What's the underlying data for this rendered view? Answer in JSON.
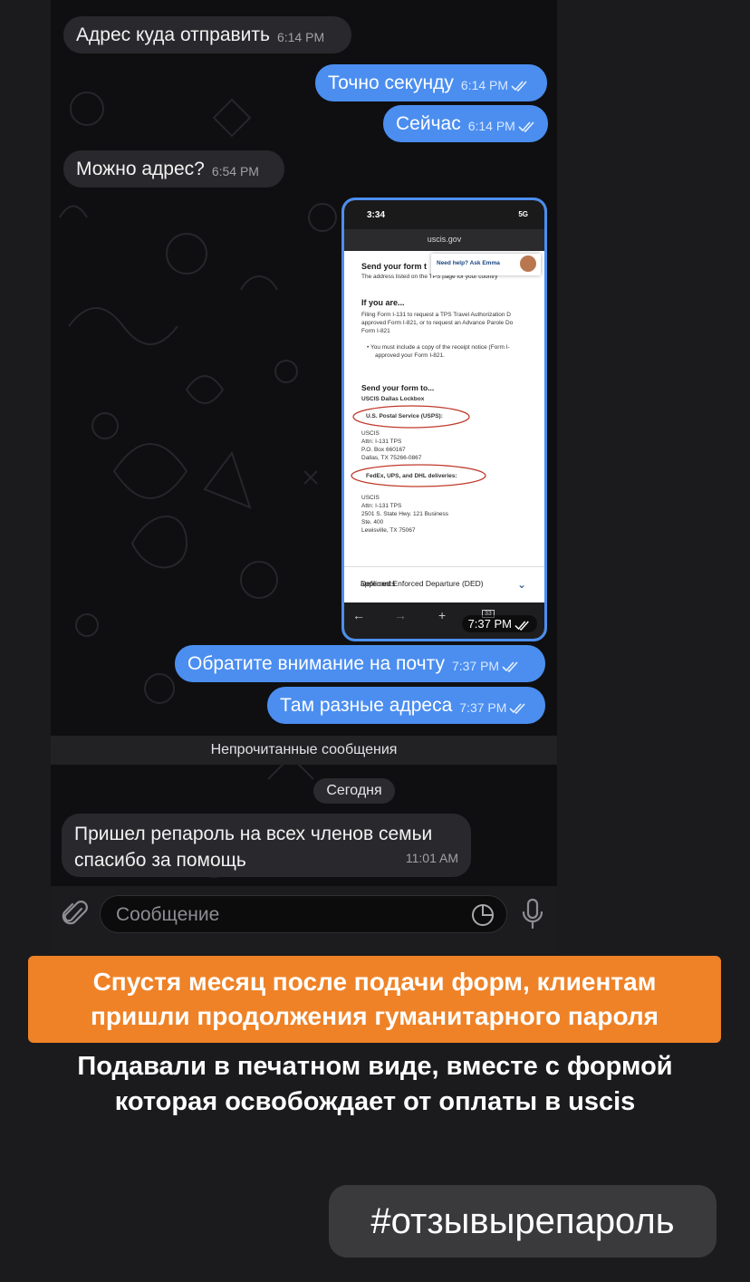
{
  "chat": {
    "messages": [
      {
        "text": "Адрес куда отправить",
        "time": "6:14 PM"
      },
      {
        "text": "Точно секунду",
        "time": "6:14 PM"
      },
      {
        "text": "Сейчас",
        "time": "6:14 PM"
      },
      {
        "text": "Можно адрес?",
        "time": "6:54 PM"
      },
      {
        "text": "Обратите внимание на почту",
        "time": "7:37 PM"
      },
      {
        "text": "Там разные адреса",
        "time": "7:37 PM"
      },
      {
        "text_line1": "Пришел репароль на всех членов семьи",
        "text_line2": "спасибо за помощь",
        "time": "11:01 AM"
      }
    ],
    "unread_label": "Непрочитанные сообщения",
    "date_label": "Сегодня",
    "image_message": {
      "time": "7:37 PM",
      "status_time": "3:34",
      "status_carrier": "5G",
      "url": "uscis.gov",
      "help_text": "Need help? Ask Emma",
      "send_form_title": "Send your form t",
      "send_form_sub": "The address listed on the TPS page for your country",
      "if_you_are": "If you are...",
      "filing_line1": "Filing Form I-131 to request a TPS Travel Authorization D",
      "filing_line2": "approved Form I-821, or to request an Advance Parole Do",
      "filing_line3": "Form I-821",
      "bullet_line1": "• You must include a copy of the receipt notice (Form I-",
      "bullet_line2": "approved your Form I-821.",
      "send_to": "Send your form to...",
      "lockbox": "USCIS Dallas Lockbox",
      "usps_label": "U.S. Postal Service (USPS):",
      "usps_addr": [
        "USCIS",
        "Attn: I-131 TPS",
        "P.O. Box 660167",
        "Dallas, TX 75266-0867"
      ],
      "courier_label": "FedEx, UPS, and DHL deliveries:",
      "courier_addr": [
        "USCIS",
        "Attn: I-131 TPS",
        "2501 S. State Hwy. 121 Business",
        "Ste. 400",
        "Lewisville, TX 75067"
      ],
      "ded_line1": "Deferred Enforced Departure (DED)",
      "ded_line2": "applicants",
      "tab_count": "33"
    }
  },
  "composer": {
    "placeholder": "Сообщение"
  },
  "caption": {
    "orange_line1": "Спустя месяц после подачи форм, клиентам",
    "orange_line2": "пришли продолжения гуманитарного пароля",
    "white_line1": "Подавали в печатном виде, вместе с формой",
    "white_line2": "которая освобождает от оплаты в uscis"
  },
  "hashtag": "#отзывырепароль",
  "colors": {
    "outgoing": "#4b8ef0",
    "incoming": "#29282c",
    "banner": "#ef8227",
    "annotation": "#c0392b"
  }
}
